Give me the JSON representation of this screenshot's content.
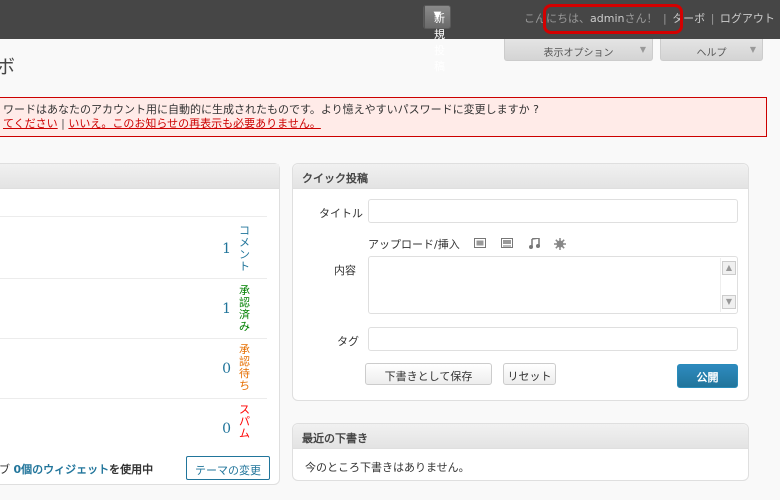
{
  "topbar": {
    "new_post_label": "新規投稿",
    "new_post_arrow": "▼",
    "greeting_prefix": "こんにちは、",
    "username": "admin",
    "greeting_suffix": "さん！",
    "sep": "|",
    "turbo": "ターボ",
    "logout": "ログアウト"
  },
  "tabs": {
    "screen_options": "表示オプション",
    "help": "ヘルプ",
    "arrow": "▼"
  },
  "page_title": "ボ",
  "notice": {
    "line1": "ワードはあなたのアカウント用に自動的に生成されたものです。より憶えやすいパスワードに変更しますか ?",
    "link_yes": "てください",
    "sep": "|",
    "link_no": "いいえ。このお知らせの再表示も必要ありません。"
  },
  "right_now": {
    "rows": [
      {
        "count": "1",
        "label": "コメント",
        "color": "#21759b"
      },
      {
        "count": "1",
        "label": "承認済み",
        "color": "#008000"
      },
      {
        "count": "0",
        "label": "承認待ち",
        "color": "#e66f00"
      },
      {
        "count": "0",
        "label": "スパム",
        "color": "#ff0000"
      }
    ],
    "widget_prefix": "ブ",
    "widget_link": "0個のウィジェット",
    "widget_suffix": "を使用中",
    "change_theme": "テーマの変更"
  },
  "quick_post": {
    "title": "クイック投稿",
    "title_label": "タイトル",
    "upload_label": "アップロード/挿入",
    "media_icons": [
      "image-icon",
      "video-icon",
      "audio-icon",
      "media-icon"
    ],
    "content_label": "内容",
    "tags_label": "タグ",
    "save_draft": "下書きとして保存",
    "reset": "リセット",
    "publish": "公開"
  },
  "drafts": {
    "title": "最近の下書き",
    "empty": "今のところ下書きはありません。"
  }
}
